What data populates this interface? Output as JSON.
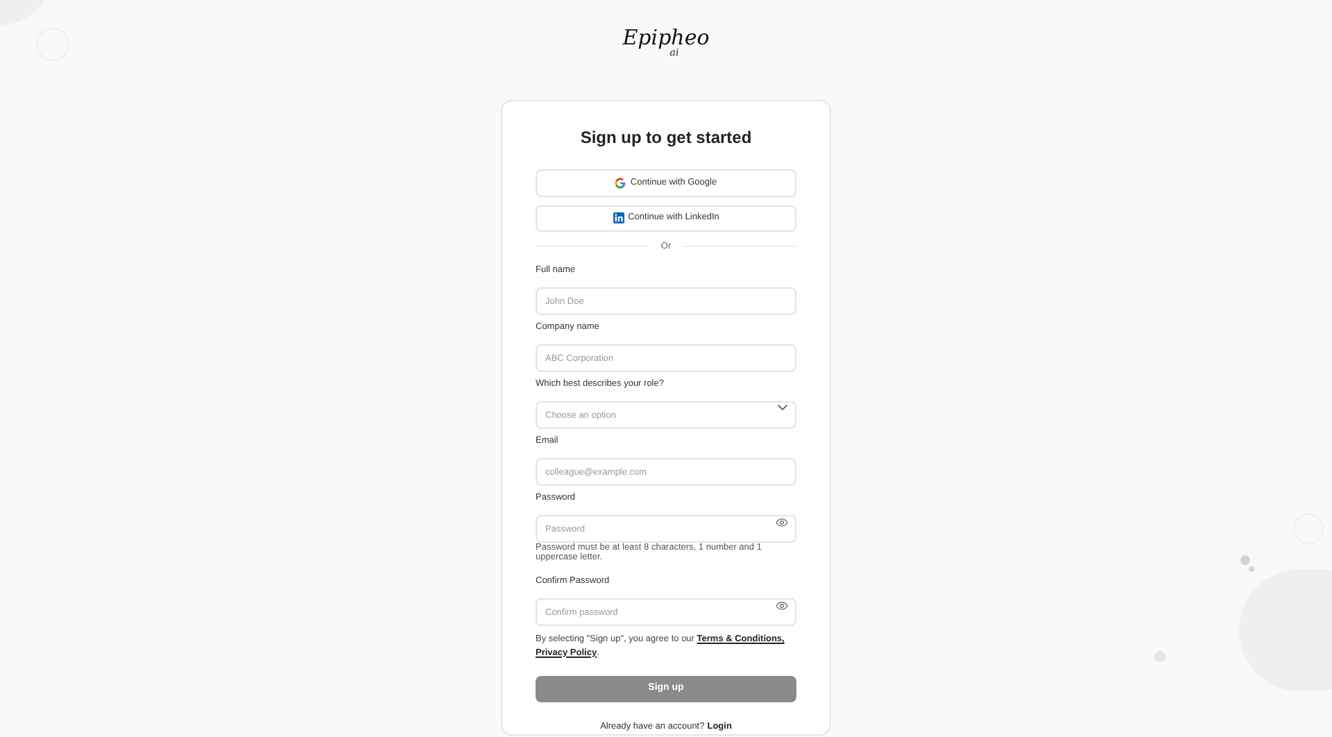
{
  "logo": {
    "word": "Epipheo",
    "sub": "ai"
  },
  "title": "Sign up to get started",
  "social_buttons": [
    {
      "kind": "google",
      "label": "Continue with Google"
    },
    {
      "kind": "linkedin",
      "label": "Continue with LinkedIn"
    }
  ],
  "divider": "Or",
  "fields": [
    {
      "kind": "text",
      "label": "Full name",
      "placeholder": "John Doe"
    },
    {
      "kind": "text",
      "label": "Company name",
      "placeholder": "ABC Corporation"
    },
    {
      "kind": "select",
      "label": "Which best describes your role?",
      "placeholder": "Choose an option"
    },
    {
      "kind": "text",
      "label": "Email",
      "placeholder": "colleague@example.com"
    },
    {
      "kind": "password",
      "label": "Password",
      "placeholder": "Password",
      "hint": "Password must be at least 8 characters, 1 number and 1 uppercase letter."
    },
    {
      "kind": "password",
      "label": "Confirm Password",
      "placeholder": "Confirm password"
    }
  ],
  "terms": {
    "prefix": "By selecting \"Sign up\", you agree to our",
    "links": [
      "Terms & Conditions,",
      "Privacy Policy"
    ],
    "suffix": "."
  },
  "submit": "Sign up",
  "login": {
    "text": "Already have an account?",
    "link": "Login"
  }
}
